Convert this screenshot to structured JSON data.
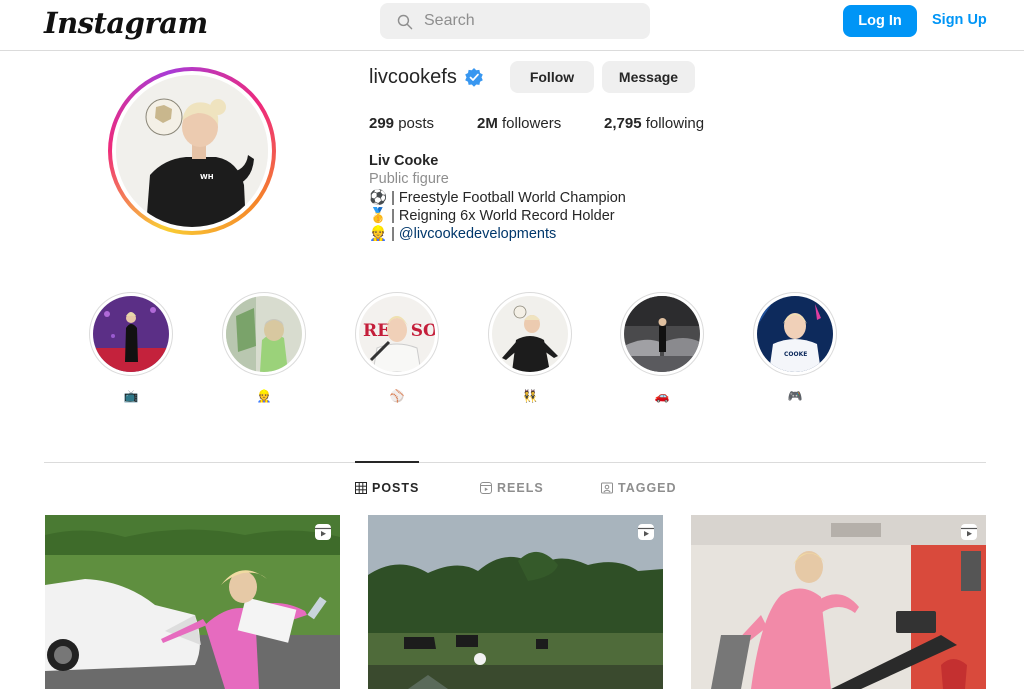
{
  "header": {
    "logo": "Instagram",
    "search_placeholder": "Search",
    "login_label": "Log In",
    "signup_label": "Sign Up"
  },
  "profile": {
    "username": "livcookefs",
    "verified": true,
    "follow_label": "Follow",
    "message_label": "Message",
    "stats": {
      "posts_count": "299",
      "posts_label": " posts",
      "followers_count": "2M",
      "followers_label": " followers",
      "following_count": "2,795",
      "following_label": " following"
    },
    "full_name": "Liv Cooke",
    "category": "Public figure",
    "bio": {
      "line1": "⚽️ | Freestyle Football World Champion",
      "line2": "🥇 | Reigning 6x World Record Holder",
      "line3_prefix": "👷 | ",
      "line3_link": "@livcookedevelopments"
    }
  },
  "highlights": [
    {
      "label": "📺"
    },
    {
      "label": "👷"
    },
    {
      "label": "⚾️"
    },
    {
      "label": "👯"
    },
    {
      "label": "🚗"
    },
    {
      "label": "🎮"
    }
  ],
  "tabs": {
    "posts": "POSTS",
    "reels": "REELS",
    "tagged": "TAGGED"
  },
  "colors": {
    "accent": "#0095f6",
    "link": "#00376b",
    "muted": "#8e8e8e",
    "verified": "#3897f0"
  }
}
